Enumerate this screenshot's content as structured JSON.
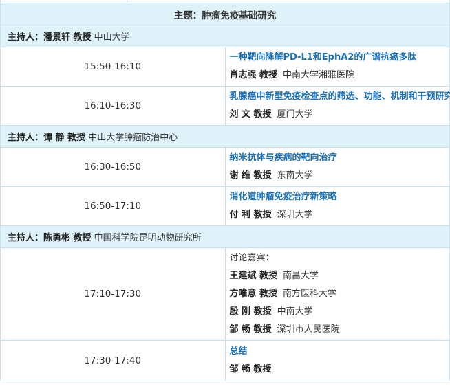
{
  "session_theme": "主题：肿瘤免疫基础研究",
  "blocks": [
    {
      "host": {
        "label": "主持人：潘景轩 教授",
        "affiliation": "中山大学"
      },
      "talks": [
        {
          "time": "15:50-16:10",
          "title": "一种靶向降解PD-L1和EphA2的广谱抗癌多肽",
          "speaker": "肖志强 教授",
          "affiliation": "中南大学湘雅医院"
        },
        {
          "time": "16:10-16:30",
          "title": "乳腺癌中新型免疫检查点的筛选、功能、机制和干预研究",
          "speaker": "刘 文 教授",
          "affiliation": "厦门大学"
        }
      ]
    },
    {
      "host": {
        "label": "主持人：谭 静 教授",
        "affiliation": "中山大学肿瘤防治中心"
      },
      "talks": [
        {
          "time": "16:30-16:50",
          "title": "纳米抗体与疾病的靶向治疗",
          "speaker": "谢 维 教授",
          "affiliation": "东南大学"
        },
        {
          "time": "16:50-17:10",
          "title": "消化道肿瘤免疫治疗新策略",
          "speaker": "付 利 教授",
          "affiliation": "深圳大学"
        }
      ]
    },
    {
      "host": {
        "label": "主持人：陈勇彬 教授",
        "affiliation": "中国科学院昆明动物研究所"
      },
      "discussion": {
        "time": "17:10-17:30",
        "label": "讨论嘉宾：",
        "guests": [
          {
            "name": "王建斌 教授",
            "affiliation": "南昌大学"
          },
          {
            "name": "方唯意 教授",
            "affiliation": "南方医科大学"
          },
          {
            "name": "殷 刚 教授",
            "affiliation": "中南大学"
          },
          {
            "name": "邹 畅 教授",
            "affiliation": "深圳市人民医院"
          }
        ]
      },
      "closing": {
        "time": "17:30-17:40",
        "title": "总结",
        "speaker": "邹 畅 教授"
      }
    }
  ]
}
